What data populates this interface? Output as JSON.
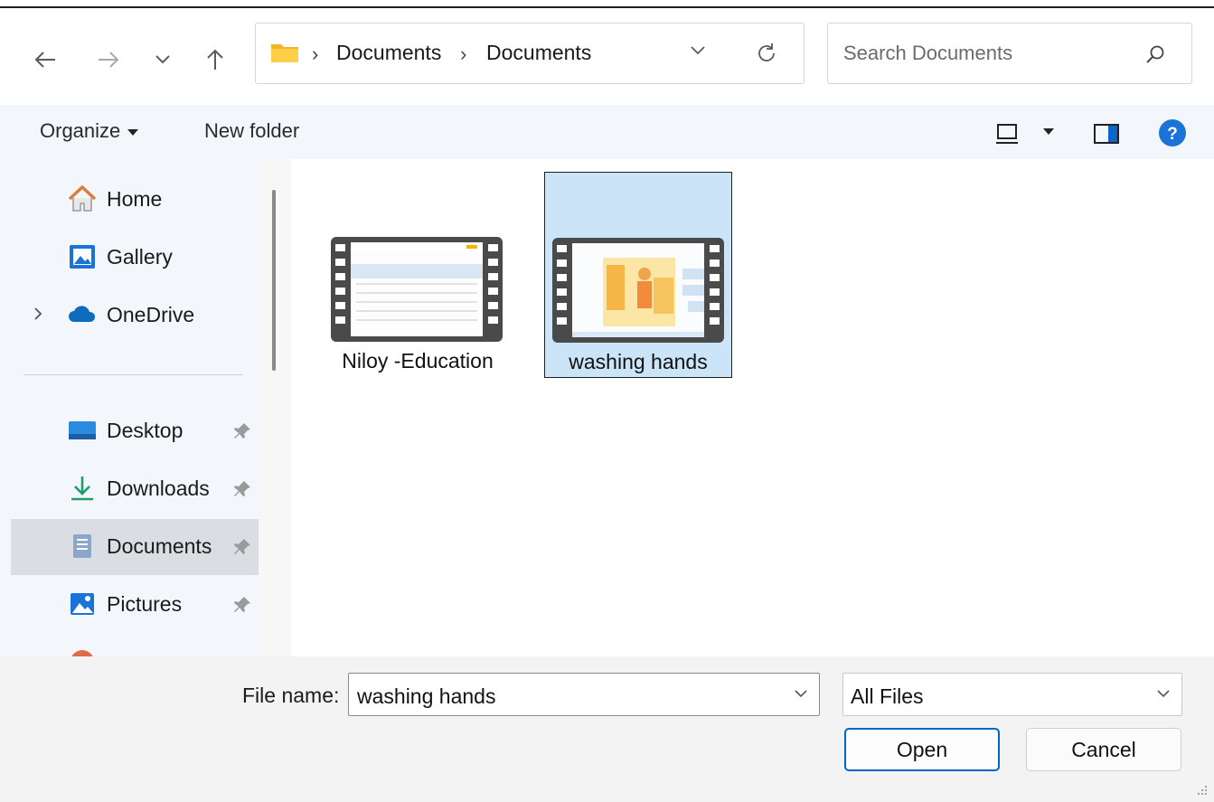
{
  "address": {
    "crumbs": [
      "Documents",
      "Documents"
    ],
    "search_placeholder": "Search Documents"
  },
  "toolbar": {
    "organize": "Organize",
    "new_folder": "New folder"
  },
  "sidebar": {
    "items": [
      {
        "label": "Home",
        "icon": "home-icon"
      },
      {
        "label": "Gallery",
        "icon": "gallery-icon"
      },
      {
        "label": "OneDrive",
        "icon": "onedrive-icon"
      },
      {
        "label": "Desktop",
        "icon": "desktop-icon",
        "pinned": true
      },
      {
        "label": "Downloads",
        "icon": "download-icon",
        "pinned": true
      },
      {
        "label": "Documents",
        "icon": "documents-icon",
        "pinned": true,
        "selected": true
      },
      {
        "label": "Pictures",
        "icon": "pictures-icon",
        "pinned": true
      }
    ]
  },
  "files": [
    {
      "name": "Niloy -Education",
      "icon": "video-file-icon",
      "selected": false
    },
    {
      "name": "washing hands",
      "icon": "video-file-icon",
      "selected": true
    }
  ],
  "bottom": {
    "file_name_label": "File name:",
    "file_name_value": "washing hands",
    "file_type": "All Files",
    "open": "Open",
    "cancel": "Cancel"
  },
  "colors": {
    "accent": "#0067c0",
    "selection": "#cce4f7",
    "help": "#1a73d9"
  }
}
